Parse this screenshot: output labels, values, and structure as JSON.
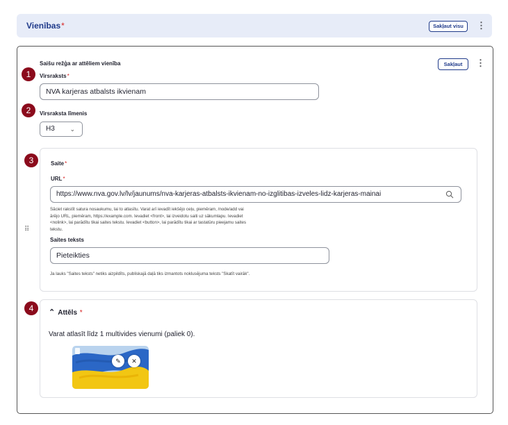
{
  "header": {
    "title": "Vienības",
    "required_mark": "*",
    "collapse_all_label": "Sakļaut visu",
    "more_icon": "⋮"
  },
  "panel": {
    "title": "Saišu režģa ar attēliem vienība",
    "collapse_label": "Sakļaut",
    "more_icon": "⋮"
  },
  "markers": [
    "1",
    "2",
    "3",
    "4"
  ],
  "heading_field": {
    "label": "Virsraksts",
    "required_mark": "*",
    "value": "NVA karjeras atbalsts ikvienam"
  },
  "heading_level": {
    "label": "Virsraksta līmenis",
    "value": "H3"
  },
  "link": {
    "title": "Saite",
    "required_mark": "*",
    "url_label": "URL",
    "url_value": "https://www.nva.gov.lv/lv/jaunums/nva-karjeras-atbalsts-ikvienam-no-izglitibas-izveles-lidz-karjeras-mainai",
    "url_help_lines": [
      "Sāciet rakstīt satura nosaukumu, lai to atlasītu. Varat arī ievadīt iekšējo ceļu, piemēram, /node/add vai",
      "ārējo URL, piemēram, https://example.com. Ievadiet <front>, lai izveidotu saiti uz sākumlapu. Ievadiet",
      "<nolink>, lai parādītu tikai saites tekstu. Ievadiet <button>, lai parādītu tikai ar tastatūru pieejamu saites",
      "tekstu."
    ],
    "text_label": "Saites teksts",
    "text_value": "Pieteikties",
    "text_help": "Ja lauks \"Saites teksts\" netiks aizpildīts, publiskajā daļā tiks izmantots noklusējuma teksts \"Skatīt vairāk\"."
  },
  "image": {
    "title": "Attēls",
    "required_mark": "*",
    "info": "Varat atlasīt līdz 1 multivides vienumi (paliek 0).",
    "edit_icon": "pencil-icon",
    "remove_icon": "close-icon"
  },
  "colors": {
    "accent": "#1f3a8a",
    "marker": "#8b0b1c",
    "required": "#d72222",
    "header_bg": "#e7ecf8"
  }
}
